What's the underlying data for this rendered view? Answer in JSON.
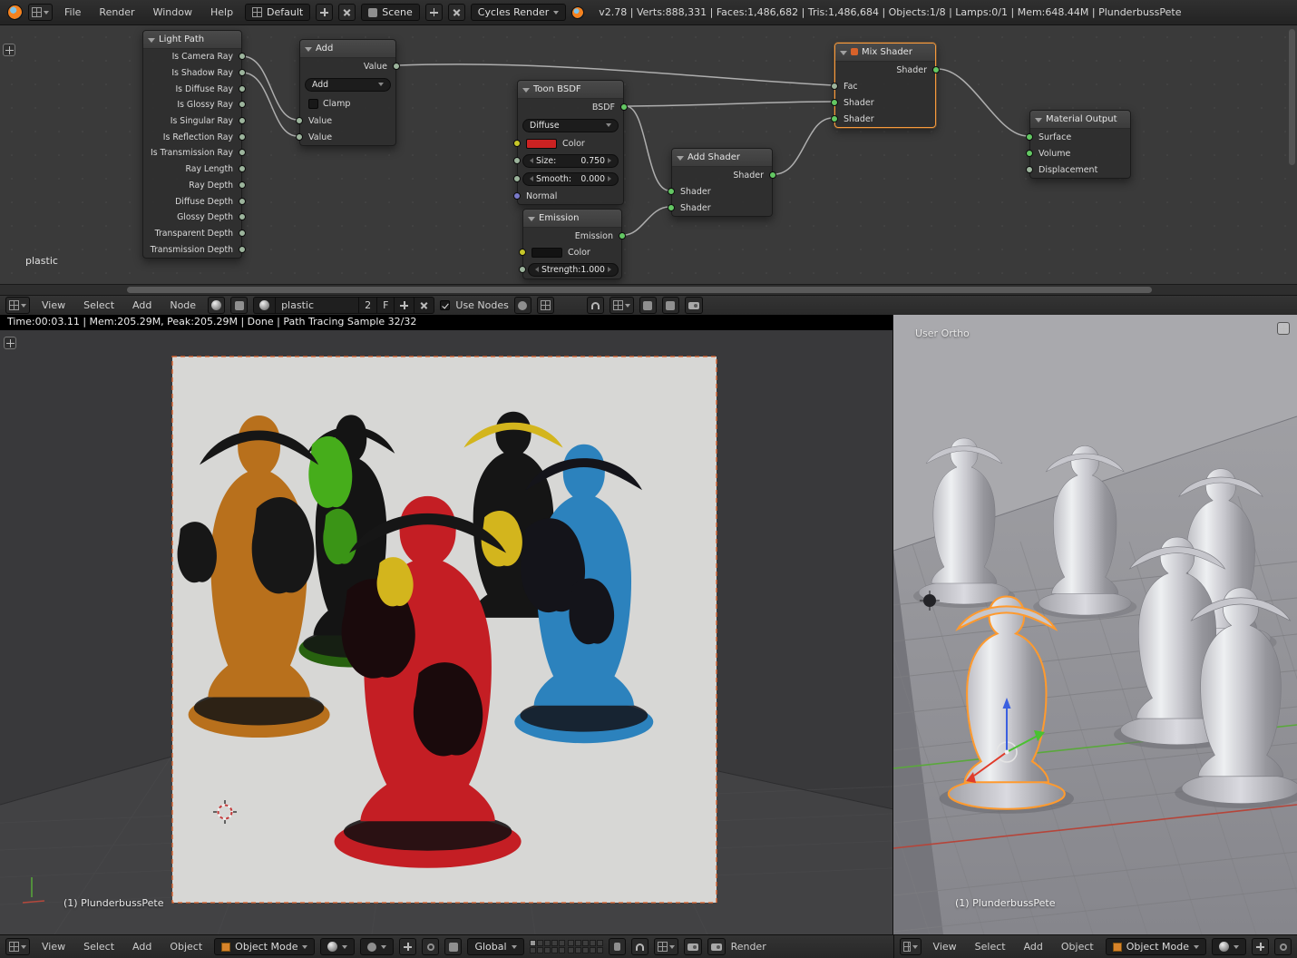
{
  "top_header": {
    "menus": [
      "File",
      "Render",
      "Window",
      "Help"
    ],
    "layout": {
      "value": "Default"
    },
    "scene": {
      "value": "Scene"
    },
    "engine": {
      "value": "Cycles Render"
    },
    "stats": "v2.78 | Verts:888,331 | Faces:1,486,682 | Tris:1,486,684 | Objects:1/8 | Lamps:0/1 | Mem:648.44M | PlunderbussPete"
  },
  "node_editor": {
    "tree_label": "plastic",
    "header": {
      "menus": [
        "View",
        "Select",
        "Add",
        "Node"
      ],
      "material_name": "plastic",
      "material_users": "2",
      "fake_user": "F",
      "use_nodes": "Use Nodes"
    },
    "nodes": {
      "light_path": {
        "title": "Light Path",
        "outputs": [
          "Is Camera Ray",
          "Is Shadow Ray",
          "Is Diffuse Ray",
          "Is Glossy Ray",
          "Is Singular Ray",
          "Is Reflection Ray",
          "Is Transmission Ray",
          "Ray Length",
          "Ray Depth",
          "Diffuse Depth",
          "Glossy Depth",
          "Transparent Depth",
          "Transmission Depth"
        ]
      },
      "math": {
        "title": "Add",
        "output": "Value",
        "operation": "Add",
        "clamp": "Clamp",
        "inputs": [
          "Value",
          "Value"
        ]
      },
      "toon": {
        "title": "Toon BSDF",
        "output": "BSDF",
        "component": "Diffuse",
        "color": "Color",
        "size_label": "Size:",
        "size_value": "0.750",
        "smooth_label": "Smooth:",
        "smooth_value": "0.000",
        "normal": "Normal"
      },
      "emission": {
        "title": "Emission",
        "output": "Emission",
        "color": "Color",
        "strength_label": "Strength:",
        "strength_value": "1.000"
      },
      "add_shader": {
        "title": "Add Shader",
        "output": "Shader",
        "inputs": [
          "Shader",
          "Shader"
        ]
      },
      "mix_shader": {
        "title": "Mix Shader",
        "output": "Shader",
        "inputs": [
          "Fac",
          "Shader",
          "Shader"
        ]
      },
      "material_output": {
        "title": "Material Output",
        "inputs": [
          "Surface",
          "Volume",
          "Displacement"
        ]
      }
    }
  },
  "left_viewport": {
    "render_stats": "Time:00:03.11 | Mem:205.29M, Peak:205.29M | Done | Path Tracing Sample 32/32",
    "object_label": "(1) PlunderbussPete"
  },
  "right_viewport": {
    "view_label": "User Ortho",
    "object_label": "(1) PlunderbussPete"
  },
  "left_footer": {
    "menus": [
      "View",
      "Select",
      "Add",
      "Object"
    ],
    "mode": "Object Mode",
    "orientation": "Global",
    "render_label": "Render"
  },
  "right_footer": {
    "menus": [
      "View",
      "Select",
      "Add",
      "Object"
    ],
    "mode": "Object Mode"
  },
  "colors": {
    "selection_orange": "#ff9a2e",
    "toon_red": "#c41e24",
    "toon_orange": "#b8701c",
    "toon_green": "#49b41c",
    "toon_yellow": "#d3b51d",
    "toon_blue": "#2c82bd"
  }
}
